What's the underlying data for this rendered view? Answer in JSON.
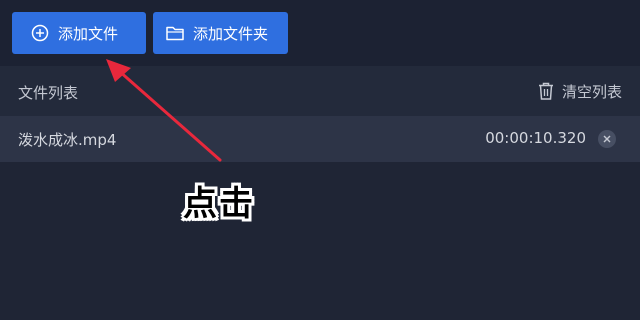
{
  "toolbar": {
    "add_file_label": "添加文件",
    "add_folder_label": "添加文件夹",
    "add_file_icon": "plus-circle-icon",
    "add_folder_icon": "folder-icon"
  },
  "list": {
    "title": "文件列表",
    "clear_label": "清空列表",
    "clear_icon": "trash-icon",
    "files": [
      {
        "name": "泼水成冰.mp4",
        "duration": "00:00:10.320",
        "remove_icon": "close-icon"
      }
    ]
  },
  "annotation": {
    "label": "点击",
    "arrow_color": "#e8283c"
  },
  "colors": {
    "background": "#1f2535",
    "accent": "#2f6fe0",
    "row_highlight": "#2d3447"
  }
}
